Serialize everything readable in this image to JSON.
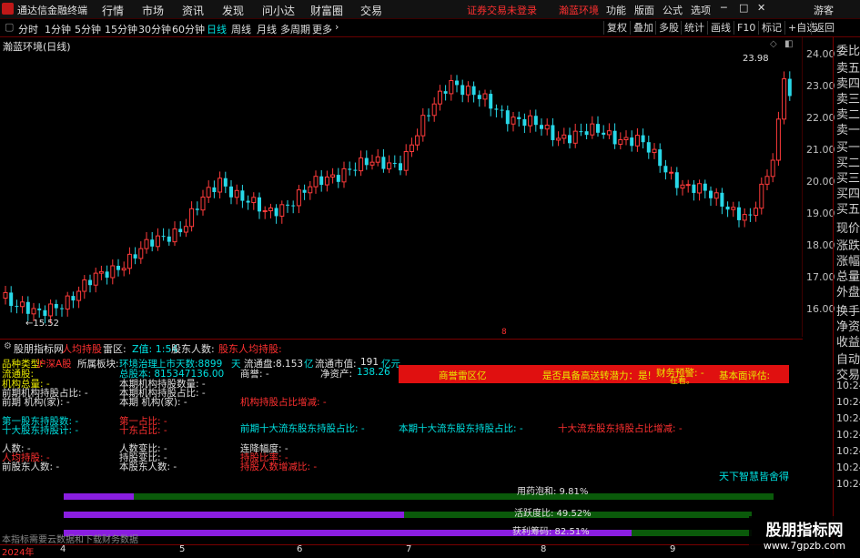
{
  "app": {
    "title": "通达信金融终端",
    "menu": [
      "行情",
      "市场",
      "资讯",
      "发现",
      "问小达",
      "财富圈",
      "交易"
    ],
    "login_status": "证券交易未登录",
    "stock_name": "瀚蓝环境",
    "right_menu": [
      "功能",
      "版面",
      "公式",
      "选项"
    ],
    "guest": "游客"
  },
  "periods": [
    "分时",
    "1分钟",
    "5分钟",
    "15分钟",
    "30分钟",
    "60分钟",
    "日线",
    "周线",
    "月线",
    "多周期",
    "更多"
  ],
  "active_period": "日线",
  "tools": [
    "复权",
    "叠加",
    "多股",
    "统计",
    "画线",
    "F10",
    "标记",
    "+自选",
    "返回"
  ],
  "chart": {
    "title": "瀚蓝环境(日线)",
    "high_label": "23.98",
    "low_label": "15.52",
    "marker": "8"
  },
  "y_axis": [
    "24.00",
    "23.00",
    "22.00",
    "21.00",
    "20.00",
    "19.00",
    "18.00",
    "17.00",
    "16.00"
  ],
  "right_panel": [
    "委比",
    "卖五",
    "卖四",
    "卖三",
    "卖二",
    "卖一",
    "买一",
    "买二",
    "买三",
    "买四",
    "买五",
    "现价",
    "涨跌",
    "涨幅",
    "总量",
    "外盘",
    "换手",
    "净资",
    "收益",
    "自动",
    "交易",
    "10:24",
    "10:24",
    "10:24",
    "10:24",
    "10:24",
    "10:24",
    "10:24"
  ],
  "indicator": {
    "name": "股朋指标网",
    "b": "人均持股",
    "c": "雷区:",
    "d": "Z值: 1:54",
    "e": "股东人数:",
    "f": "股东人均持股:"
  },
  "fields": {
    "r1": {
      "a": "品种类型:",
      "b": "沪深A股",
      "c": "所属板块:",
      "d": "环境治理",
      "e": "上市天数:8899",
      "f": "天",
      "g": "流通盘:8.153",
      "h": "亿",
      "i": "流通市值:",
      "j": "191",
      "k": "亿元"
    },
    "r2": {
      "a": "流通股:",
      "b": "总股本: 815347136.00",
      "c": "商誉: -",
      "d": "净资产:",
      "e": "138.26"
    },
    "r3": {
      "a": "机构总量: -",
      "b": "本期机构持股数量: -"
    },
    "r4": {
      "a": "前期机构持股占比: -",
      "b": "本期机构持股占比: -"
    },
    "r5": {
      "a": "前期 机构(家): -",
      "b": "本期 机构(家): -",
      "c": "机构持股占比增减: -"
    },
    "r6": {
      "a": "第一股东持股数: -",
      "b": "第一占比: -"
    },
    "r7": {
      "a": "十大股东持股计: -",
      "b": "十东占比: -",
      "c": "前期十大流东股东持股占比: -",
      "d": "本期十大流东股东持股占比: -",
      "e": "十大流东股东持股占比增减: -"
    },
    "r8": {
      "a": "人数: -",
      "b": "人数变比: -",
      "c": "连降幅度: -"
    },
    "r9": {
      "a": "人均持股: -",
      "b": "持股变比: -",
      "c": "持股比率: -"
    },
    "r10": {
      "a": "前股东人数: -",
      "b": "本股东人数: -",
      "c": "持股人数增减比: -"
    }
  },
  "alert": {
    "a": "商誉雷区亿",
    "b": "是否具备高送转潜力：是!",
    "c": "财务预警: -",
    "d": "基本面评估:",
    "e": "在看。"
  },
  "slogan": "天下智慧皆舍得",
  "bars": [
    {
      "label": "用药泡和: 9.81%",
      "value": 9.81
    },
    {
      "label": "活跃度比: 49.52%",
      "value": 49.52
    },
    {
      "label": "获利筹码: 82.51%",
      "value": 82.51
    }
  ],
  "bottom_note": "本指标需要云数据和下载财务数据",
  "x_axis": [
    "2024年",
    "4",
    "5",
    "6",
    "7",
    "8",
    "9"
  ],
  "watermark": {
    "main": "股朋指标网",
    "url": "www.7gpzb.com"
  },
  "colors": {
    "up": "#ff3b3b",
    "down": "#28d8e8",
    "axis": "#7a0000",
    "bar_purple": "#8a1ee0",
    "bar_green": "#0a5a0a",
    "alert": "#e01010"
  }
}
